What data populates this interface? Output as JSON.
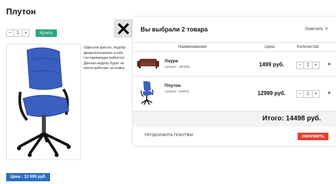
{
  "product": {
    "title": "Плутон",
    "qty_minus": "−",
    "qty_value": "1",
    "qty_plus": "+",
    "buy_label": "Купить",
    "description_lines": [
      "Офисное кресло, подобр",
      "физиологических особе",
      "составляющая работосп",
      "Данная модель будет не",
      "много работает за компь"
    ],
    "price_label": "Цена : 12 999 руб."
  },
  "modal": {
    "close_icon": "close-icon",
    "title": "Вы выбрали 2 товара",
    "clear_label": "Очистить",
    "clear_icon": "×",
    "columns": {
      "name": "Наименование",
      "price": "Цена",
      "qty": "Количество"
    },
    "items": [
      {
        "name": "Лаура",
        "sku": "Артикул : 382638",
        "price": "1499 руб.",
        "qty": "1",
        "minus": "−",
        "plus": "+",
        "remove": "×",
        "thumb_icon": "sofa-icon"
      },
      {
        "name": "Плутон",
        "sku": "Артикул : 634011",
        "price": "12999 руб.",
        "qty": "1",
        "minus": "−",
        "plus": "+",
        "remove": "×",
        "thumb_icon": "office-chair-icon"
      }
    ],
    "total": "Итого: 14498 руб.",
    "continue_label": "ПРОДОЛЖИТЬ ПОКУПКИ",
    "checkout_label": "ОФОРМИТЬ"
  },
  "colors": {
    "buy_button": "#2aa680",
    "price_badge": "#2b6cc4",
    "checkout_button": "#e8412f",
    "chair_blue": "#3a5fc0"
  }
}
